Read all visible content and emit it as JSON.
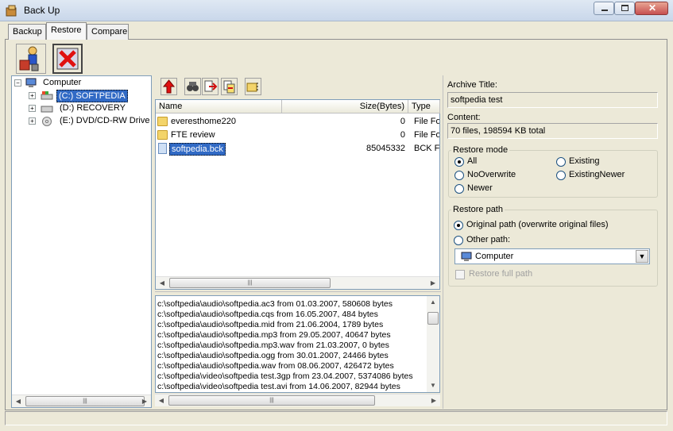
{
  "window": {
    "title": "Back Up"
  },
  "tabs": [
    {
      "label": "Backup"
    },
    {
      "label": "Restore"
    },
    {
      "label": "Compare"
    }
  ],
  "tree": {
    "root": "Computer",
    "drives": [
      {
        "label": "(C:) SOFTPEDIA",
        "selected": true
      },
      {
        "label": "(D:) RECOVERY",
        "selected": false
      },
      {
        "label": "(E:) DVD/CD-RW Drive",
        "selected": false
      }
    ]
  },
  "filelist": {
    "columns": {
      "name": "Name",
      "size": "Size(Bytes)",
      "type": "Type"
    },
    "rows": [
      {
        "name": "everesthome220",
        "size": "0",
        "type": "File Folder",
        "kind": "folder"
      },
      {
        "name": "FTE review",
        "size": "0",
        "type": "File Folder",
        "kind": "folder"
      },
      {
        "name": "softpedia.bck",
        "size": "85045332",
        "type": "BCK File",
        "kind": "file",
        "selected": true
      }
    ]
  },
  "log": [
    "c:\\softpedia\\audio\\softpedia.ac3 from 01.03.2007, 580608 bytes",
    "c:\\softpedia\\audio\\softpedia.cqs from 16.05.2007, 484 bytes",
    "c:\\softpedia\\audio\\softpedia.mid from 21.06.2004, 1789 bytes",
    "c:\\softpedia\\audio\\softpedia.mp3 from 29.05.2007, 40647 bytes",
    "c:\\softpedia\\audio\\softpedia.mp3.wav from 21.03.2007, 0 bytes",
    "c:\\softpedia\\audio\\softpedia.ogg from 30.01.2007, 24466 bytes",
    "c:\\softpedia\\audio\\softpedia.wav from 08.06.2007, 426472 bytes",
    "c:\\softpedia\\video\\softpedia test.3gp from 23.04.2007, 5374086 bytes",
    "c:\\softpedia\\video\\softpedia test.avi from 14.06.2007, 82944 bytes"
  ],
  "details": {
    "archive_title_label": "Archive Title:",
    "archive_title_value": "softpedia test",
    "content_label": "Content:",
    "content_value": "70 files, 198594 KB total"
  },
  "restore_mode": {
    "label": "Restore mode",
    "options": {
      "all": "All",
      "nooverwrite": "NoOverwrite",
      "newer": "Newer",
      "existing": "Existing",
      "existingnewer": "ExistingNewer"
    },
    "selected": "All"
  },
  "restore_path": {
    "label": "Restore path",
    "original": "Original path (overwrite original files)",
    "other": "Other path:",
    "dropdown_value": "Computer",
    "full_path": "Restore full path",
    "selected": "Original path (overwrite original files)"
  },
  "colors": {
    "selection": "#316ac5",
    "accent": "#1c5180"
  }
}
